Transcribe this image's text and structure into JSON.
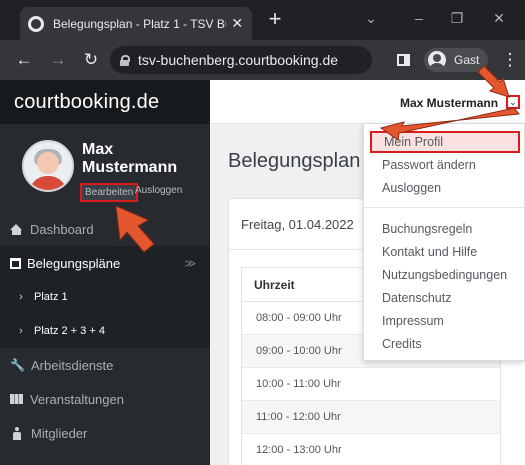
{
  "browser": {
    "tab_title": "Belegungsplan - Platz 1 - TSV Bu",
    "tab_close": "✕",
    "new_tab": "+",
    "controls": {
      "dropdown": "⌄",
      "minimize": "–",
      "maximize": "❐",
      "close": "✕"
    },
    "nav": {
      "back": "←",
      "forward": "→",
      "reload": "↻",
      "more": "⋮"
    },
    "url": "tsv-buchenberg.courtbooking.de",
    "profile_label": "Gast"
  },
  "app": {
    "brand": "courtbooking.de",
    "user": {
      "first_name": "Max",
      "last_name": "Mustermann",
      "edit_label": "Bearbeiten",
      "logout_label": "Ausloggen"
    },
    "sidebar": {
      "items": [
        {
          "label": "Dashboard"
        },
        {
          "label": "Belegungspläne",
          "caret": "≫"
        },
        {
          "label": "Platz 1",
          "marker": "›"
        },
        {
          "label": "Platz 2 + 3 + 4",
          "marker": "›"
        },
        {
          "label": "Arbeitsdienste"
        },
        {
          "label": "Veranstaltungen"
        },
        {
          "label": "Mitglieder"
        }
      ]
    },
    "topbar": {
      "user_name": "Max Mustermann",
      "chevron": "⌄"
    },
    "page_title": "Belegungsplan",
    "card": {
      "date": "Freitag, 01.04.2022",
      "table_header": "Uhrzeit",
      "rows": [
        "08:00 - 09:00 Uhr",
        "09:00 - 10:00 Uhr",
        "10:00 - 11:00 Uhr",
        "11:00 - 12:00 Uhr",
        "12:00 - 13:00 Uhr"
      ]
    },
    "dropdown": {
      "group1": [
        "Mein Profil",
        "Passwort ändern",
        "Ausloggen"
      ],
      "group2": [
        "Buchungsregeln",
        "Kontakt und Hilfe",
        "Nutzungsbedingungen",
        "Datenschutz",
        "Impressum",
        "Credits"
      ]
    }
  },
  "annotations": {
    "arrow_color": "#e4572e",
    "highlight_color": "#d91c1c"
  }
}
